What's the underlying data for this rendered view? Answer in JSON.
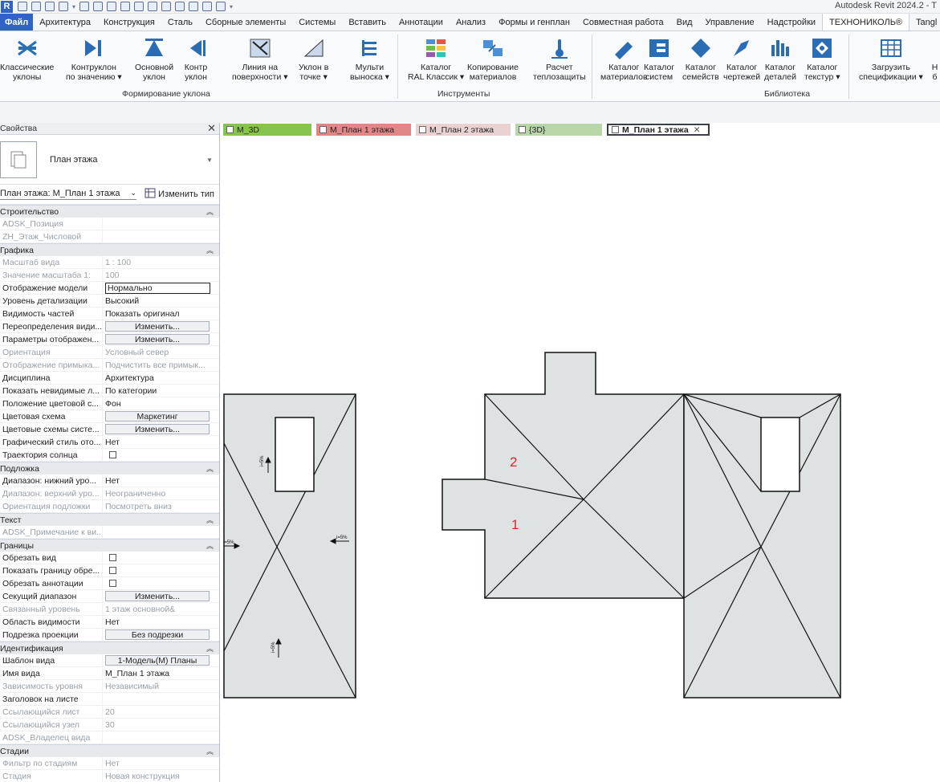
{
  "app_title": "Autodesk Revit 2024.2 - T",
  "logo_letter": "R",
  "menu": {
    "tabs": [
      "Файл",
      "Архитектура",
      "Конструкция",
      "Сталь",
      "Сборные элементы",
      "Системы",
      "Вставить",
      "Аннотации",
      "Анализ",
      "Формы и генплан",
      "Совместная работа",
      "Вид",
      "Управление",
      "Надстройки",
      "ТЕХНОНИКОЛЬ®",
      "Tangl"
    ],
    "active_tab": "ТЕХНОНИКОЛЬ®"
  },
  "ribbon": {
    "buttons": [
      {
        "line1": "Классические",
        "line2": "уклоны",
        "icon": "arrows-in-icon"
      },
      {
        "line1": "Контруклон",
        "line2": "по значению ▾",
        "icon": "counter-slope-icon"
      },
      {
        "line1": "Основной",
        "line2": "уклон",
        "icon": "main-slope-icon"
      },
      {
        "line1": "Контр",
        "line2": "уклон",
        "icon": "counter-icon"
      },
      {
        "line1": "Линия на",
        "line2": "поверхности ▾",
        "icon": "surface-line-icon"
      },
      {
        "line1": "Уклон в",
        "line2": "точке ▾",
        "icon": "point-slope-icon"
      },
      {
        "line1": "Мульти",
        "line2": "выноска ▾",
        "icon": "multi-leader-icon"
      },
      {
        "line1": "Каталог",
        "line2": "RAL Классик ▾",
        "icon": "ral-catalog-icon"
      },
      {
        "line1": "Копирование",
        "line2": "материалов",
        "icon": "copy-materials-icon"
      },
      {
        "line1": "Расчет",
        "line2": "теплозащиты",
        "icon": "thermal-calc-icon"
      },
      {
        "line1": "Каталог",
        "line2": "материалов",
        "icon": "materials-catalog-icon"
      },
      {
        "line1": "Каталог",
        "line2": "систем",
        "icon": "systems-catalog-icon"
      },
      {
        "line1": "Каталог",
        "line2": "семейств",
        "icon": "families-catalog-icon"
      },
      {
        "line1": "Каталог",
        "line2": "чертежей",
        "icon": "drawings-catalog-icon"
      },
      {
        "line1": "Каталог",
        "line2": "деталей",
        "icon": "details-catalog-icon"
      },
      {
        "line1": "Каталог",
        "line2": "текстур ▾",
        "icon": "textures-catalog-icon"
      },
      {
        "line1": "Загрузить",
        "line2": "спецификации ▾",
        "icon": "load-schedules-icon"
      },
      {
        "line1": "Н",
        "line2": "б",
        "icon": "cut-off-icon"
      }
    ],
    "panels": [
      "Формирование уклона",
      "Инструменты",
      "Библиотека"
    ]
  },
  "properties": {
    "header": "Свойства",
    "type_name": "План этажа",
    "instance_label": "План этажа: М_План 1 этажа",
    "edit_type": "Изменить тип",
    "groups": [
      {
        "title": "Строительство",
        "rows": [
          {
            "k": "ADSK_Позиция",
            "v": "",
            "dim": true
          },
          {
            "k": "ZH_Этаж_Числовой",
            "v": "",
            "dim": true
          }
        ]
      },
      {
        "title": "Графика",
        "rows": [
          {
            "k": "Масштаб вида",
            "v": "1 : 100",
            "dim": true
          },
          {
            "k": "Значение масштаба    1:",
            "v": "100",
            "dim": true
          },
          {
            "k": "Отображение модели",
            "v": "Нормально",
            "kind": "boxed"
          },
          {
            "k": "Уровень детализации",
            "v": "Высокий"
          },
          {
            "k": "Видимость частей",
            "v": "Показать оригинал"
          },
          {
            "k": "Переопределения види...",
            "v": "Изменить...",
            "kind": "button"
          },
          {
            "k": "Параметры отображен...",
            "v": "Изменить...",
            "kind": "button"
          },
          {
            "k": "Ориентация",
            "v": "Условный север",
            "dim": true
          },
          {
            "k": "Отображение примыка...",
            "v": "Подчистить все примык...",
            "dim": true
          },
          {
            "k": "Дисциплина",
            "v": "Архитектура"
          },
          {
            "k": "Показать невидимые л...",
            "v": "По категории"
          },
          {
            "k": "Положение цветовой с...",
            "v": "Фон"
          },
          {
            "k": "Цветовая схема",
            "v": "Маркетинг",
            "kind": "button"
          },
          {
            "k": "Цветовые схемы систе...",
            "v": "Изменить...",
            "kind": "button"
          },
          {
            "k": "Графический стиль ото...",
            "v": "Нет"
          },
          {
            "k": "Траектория солнца",
            "v": "",
            "kind": "check"
          }
        ]
      },
      {
        "title": "Подложка",
        "rows": [
          {
            "k": "Диапазон: нижний уро...",
            "v": "Нет"
          },
          {
            "k": "Диапазон: верхний уро...",
            "v": "Неограниченно",
            "dim": true
          },
          {
            "k": "Ориентация подложки",
            "v": "Посмотреть вниз",
            "dim": true
          }
        ]
      },
      {
        "title": "Текст",
        "rows": [
          {
            "k": "ADSK_Примечание к ви...",
            "v": "",
            "dim": true
          }
        ]
      },
      {
        "title": "Границы",
        "rows": [
          {
            "k": "Обрезать вид",
            "v": "",
            "kind": "check"
          },
          {
            "k": "Показать границу обре...",
            "v": "",
            "kind": "check"
          },
          {
            "k": "Обрезать аннотации",
            "v": "",
            "kind": "check"
          },
          {
            "k": "Секущий диапазон",
            "v": "Изменить...",
            "kind": "button"
          },
          {
            "k": "Связанный уровень",
            "v": "1 этаж основной&",
            "dim": true
          },
          {
            "k": "Область видимости",
            "v": "Нет"
          },
          {
            "k": "Подрезка проекции",
            "v": "Без подрезки",
            "kind": "button"
          }
        ]
      },
      {
        "title": "Идентификация",
        "rows": [
          {
            "k": "Шаблон вида",
            "v": "1-Модель(М) Планы",
            "kind": "button"
          },
          {
            "k": "Имя вида",
            "v": "М_План 1 этажа"
          },
          {
            "k": "Зависимость уровня",
            "v": "Независимый",
            "dim": true
          },
          {
            "k": "Заголовок на листе",
            "v": ""
          },
          {
            "k": "Ссылающийся лист",
            "v": "20",
            "dim": true
          },
          {
            "k": "Ссылающийся узел",
            "v": "30",
            "dim": true
          },
          {
            "k": "ADSK_Владелец вида",
            "v": "",
            "dim": true
          }
        ]
      },
      {
        "title": "Стадии",
        "rows": [
          {
            "k": "Фильтр по стадиям",
            "v": "Нет",
            "dim": true
          },
          {
            "k": "Стадия",
            "v": "Новая конструкция",
            "dim": true
          }
        ]
      }
    ]
  },
  "view_tabs": [
    {
      "label": "М_3D",
      "style": "green"
    },
    {
      "label": "М_План 1 этажа",
      "style": "red"
    },
    {
      "label": "М_План 2 этажа",
      "style": "pink"
    },
    {
      "label": "{3D}",
      "style": "lgreen"
    },
    {
      "label": "М_План 1 этажа",
      "style": "active"
    }
  ],
  "canvas": {
    "labels": [
      "2",
      "1"
    ],
    "slope_marks": [
      "i=5%",
      "i=5%",
      "i=5%",
      "i=5%"
    ]
  },
  "colors": {
    "file_tab": "#2f63c6",
    "roof_fill": "#dfe2e3",
    "label_red": "#d42b2b"
  }
}
